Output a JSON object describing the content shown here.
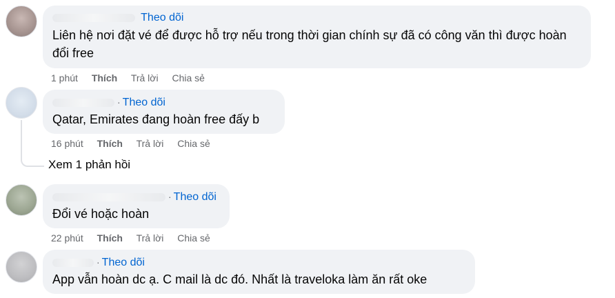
{
  "comments": [
    {
      "follow": "Theo dõi",
      "text": "Liên hệ nơi đặt vé để được hỗ trợ nếu trong thời gian chính sự đã có công văn thì được hoàn đổi free",
      "time": "1 phút",
      "like": "Thích",
      "reply": "Trả lời",
      "share": "Chia sẻ"
    },
    {
      "follow": "Theo dõi",
      "text": "Qatar, Emirates đang hoàn free đấy b",
      "time": "16 phút",
      "like": "Thích",
      "reply": "Trả lời",
      "share": "Chia sẻ",
      "replies_label": "Xem 1 phản hồi"
    },
    {
      "follow": "Theo dõi",
      "text": "Đổi vé hoặc hoàn",
      "time": "22 phút",
      "like": "Thích",
      "reply": "Trả lời",
      "share": "Chia sẻ"
    },
    {
      "follow": "Theo dõi",
      "text": "App vẫn hoàn dc ạ. C mail là dc đó. Nhất là traveloka làm ăn rất oke"
    }
  ],
  "colors": {
    "bubble": "#f0f2f5",
    "link": "#0064d1",
    "meta": "#65676b"
  }
}
